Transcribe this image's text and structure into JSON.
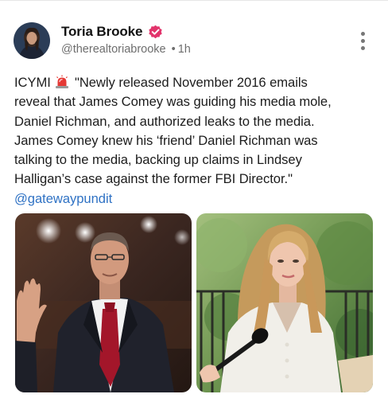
{
  "post": {
    "author_name": "Toria Brooke",
    "handle": "@therealtoriabrooke",
    "separator": "•",
    "time": "1h",
    "verified_icon": "verified-badge-icon",
    "more_icon": "more-vertical-icon",
    "text_lines": {
      "l1_prefix": "ICYMI",
      "l1_suffix": "\"Newly released November 2016 emails",
      "l2": "reveal that James Comey was guiding his media mole,",
      "l3": "Daniel Richman, and authorized leaks to the media.",
      "l4": "James Comey knew his ‘friend’ Daniel Richman was",
      "l5": "talking to the media, backing up claims in Lindsey",
      "l6": "Halligan’s case against the former FBI Director.\""
    },
    "siren_icon": "police-siren-emoji",
    "mention": "@gatewaypundit",
    "images": [
      "man-raising-hand-photo",
      "woman-with-microphone-photo"
    ]
  },
  "colors": {
    "verified": "#e2336b",
    "mention": "#2f72c4",
    "meta": "#6e6e6e"
  }
}
